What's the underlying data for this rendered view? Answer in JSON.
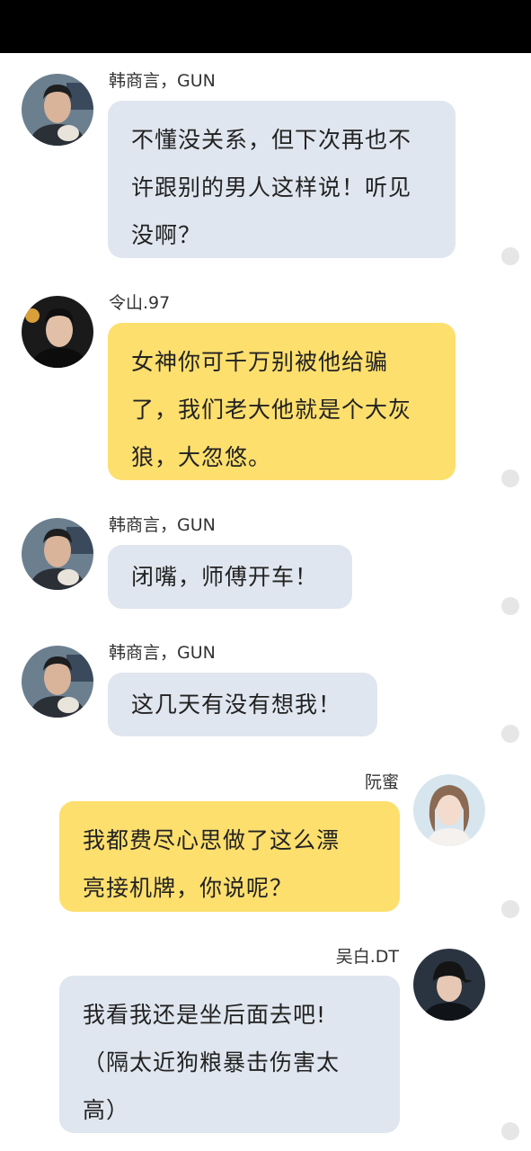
{
  "messages": [
    {
      "sender": "韩商言，GUN",
      "lines": [
        "不懂没关系，但下次再也不",
        "许跟别的男人这样说！听见",
        "没啊？"
      ],
      "color": "#e0e6ef",
      "avatar": "man-avatar-icon"
    },
    {
      "sender": "令山.97",
      "lines": [
        "女神你可千万别被他给骗",
        "了，我们老大他就是个大灰",
        "狼，大忽悠。"
      ],
      "color": "#fddf6e",
      "avatar": "young-man-avatar-icon"
    },
    {
      "sender": "韩商言，GUN",
      "lines": [
        "闭嘴，师傅开车！"
      ],
      "color": "#e0e6ef",
      "avatar": "man-avatar-icon"
    },
    {
      "sender": "韩商言，GUN",
      "lines": [
        "这几天有没有想我！"
      ],
      "color": "#e0e6ef",
      "avatar": "man-avatar-icon"
    },
    {
      "sender": "阮蜜",
      "lines": [
        "我都费尽心思做了这么漂",
        "亮接机牌，你说呢？"
      ],
      "color": "#fddf6e",
      "avatar": "woman-avatar-icon"
    },
    {
      "sender": "吴白.DT",
      "lines": [
        "我看我还是坐后面去吧!",
        "（隔太近狗粮暴击伤害太",
        "高）"
      ],
      "color": "#e0e6ef",
      "avatar": "cap-man-avatar-icon"
    }
  ]
}
